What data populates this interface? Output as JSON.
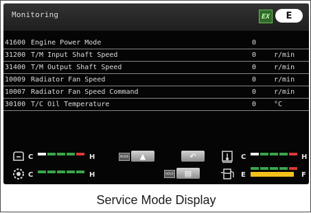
{
  "header": {
    "title": "Monitoring",
    "ex_icon_text": "EX",
    "mode_badge": "E"
  },
  "rows": [
    {
      "code": "41600",
      "name": "Engine Power Mode",
      "value": "0",
      "unit": ""
    },
    {
      "code": "31200",
      "name": "T/M Input Shaft Speed",
      "value": "0",
      "unit": "r/min"
    },
    {
      "code": "31400",
      "name": "T/M Output Shaft Speed",
      "value": "0",
      "unit": "r/min"
    },
    {
      "code": "10009",
      "name": "Radiator Fan Speed",
      "value": "0",
      "unit": "r/min"
    },
    {
      "code": "10007",
      "name": "Radiator Fan Speed Command",
      "value": "0",
      "unit": "r/min"
    },
    {
      "code": "30100",
      "name": "T/C Oil Temperature",
      "value": "0",
      "unit": "°C"
    }
  ],
  "gauges": {
    "coolant": {
      "low": "C",
      "high": "H"
    },
    "hydraulic": {
      "low": "C",
      "high": "H"
    },
    "transmission": {
      "low": "C",
      "high": "H"
    },
    "fuel": {
      "low": "E",
      "high": "F",
      "level": 0.9
    }
  },
  "switches": {
    "mode_label": "MODE",
    "hold_label": "HOLD"
  },
  "caption": "Service Mode Display",
  "icons": {
    "engine_coolant": "coolant-temperature-icon",
    "hydraulic_oil": "hydraulic-oil-temperature-icon",
    "transmission_oil": "transmission-oil-temperature-icon",
    "fuel": "fuel-pump-icon",
    "up": "up-arrow-icon",
    "return": "return-arrow-icon",
    "hold": "hold-icon"
  },
  "colors": {
    "gauge_green": "#3aa64a",
    "gauge_red": "#d83a3a",
    "fuel_yellow": "#f2c21b",
    "screen_bg": "#050505"
  }
}
